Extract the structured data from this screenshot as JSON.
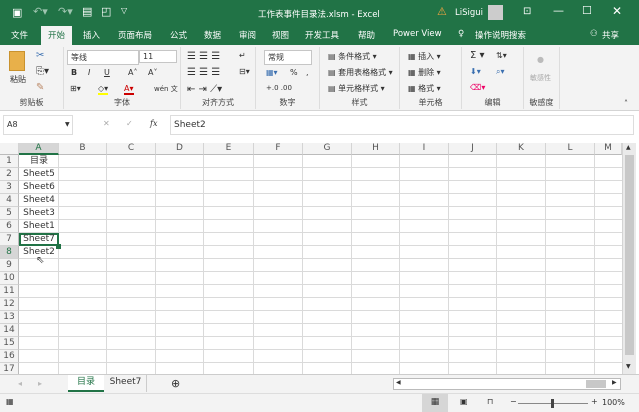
{
  "title": {
    "filename": "工作表事件目录法.xlsm - Excel",
    "user": "LiSigui",
    "qa_save": "save-icon",
    "warning": "⚠"
  },
  "tabs": [
    "文件",
    "开始",
    "插入",
    "页面布局",
    "公式",
    "数据",
    "审阅",
    "视图",
    "开发工具",
    "帮助",
    "Power View"
  ],
  "tell_me": "操作说明搜索",
  "share": "共享",
  "ribbon": {
    "clipboard": {
      "label": "剪贴板",
      "paste": "粘贴"
    },
    "font": {
      "label": "字体",
      "name": "等线",
      "size": "11",
      "bold": "B",
      "italic": "I",
      "underline": "U",
      "grow": "A˄",
      "shrink": "A˅",
      "wen": "wén 文"
    },
    "align": {
      "label": "对齐方式"
    },
    "number": {
      "label": "数字",
      "format": "常规",
      "percent": "%",
      "comma": ","
    },
    "styles": {
      "label": "样式",
      "cond": "条件格式 ▾",
      "table": "套用表格格式 ▾",
      "cell": "单元格样式 ▾"
    },
    "cells": {
      "label": "单元格",
      "insert": "插入 ▾",
      "delete": "删除 ▾",
      "format": "格式 ▾"
    },
    "edit": {
      "label": "编辑",
      "sum": "Σ ▾"
    },
    "sens": {
      "label": "敏感度",
      "btn": "敏感性"
    }
  },
  "formula": {
    "namebox": "A8",
    "fx": "fx",
    "cancel": "✕",
    "enter": "✓",
    "value": "Sheet2"
  },
  "columns": [
    "A",
    "B",
    "C",
    "D",
    "E",
    "F",
    "G",
    "H",
    "I",
    "J",
    "K",
    "L",
    "M"
  ],
  "rows": [
    "1",
    "2",
    "3",
    "4",
    "5",
    "6",
    "7",
    "8",
    "9",
    "10",
    "11",
    "12",
    "13",
    "14",
    "15",
    "16",
    "17"
  ],
  "cells_a": [
    "目录",
    "Sheet5",
    "Sheet6",
    "Sheet4",
    "Sheet3",
    "Sheet1",
    "Sheet7",
    "Sheet2"
  ],
  "sheets": [
    "目录",
    "Sheet7"
  ],
  "status": {
    "zoom": "100%"
  },
  "colors": {
    "accent": "#217346"
  }
}
